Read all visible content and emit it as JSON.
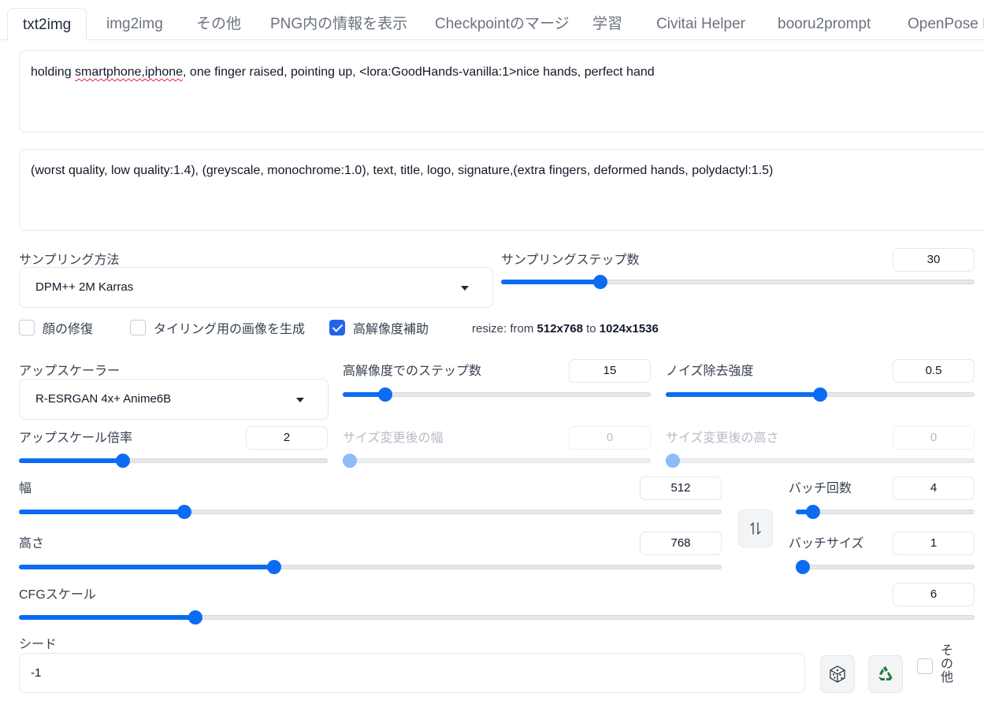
{
  "tabs": [
    "txt2img",
    "img2img",
    "その他",
    "PNG内の情報を表示",
    "Checkpointのマージ",
    "学習",
    "Civitai Helper",
    "booru2prompt",
    "OpenPose E"
  ],
  "prompt": {
    "pre": "holding ",
    "spell": "smartphone,iphone",
    "post": ", one finger raised, pointing up, <lora:GoodHands-vanilla:1>nice hands, perfect hand"
  },
  "negative_prompt": "(worst quality, low quality:1.4), (greyscale, monochrome:1.0), text, title, logo, signature,(extra fingers, deformed hands, polydactyl:1.5)",
  "sampling": {
    "method_label": "サンプリング方法",
    "method_value": "DPM++ 2M Karras",
    "steps_label": "サンプリングステップ数",
    "steps_value": "30",
    "steps_fraction": 0.2
  },
  "checks": {
    "face_restore": "顔の修復",
    "tiling": "タイリング用の画像を生成",
    "hires": "高解像度補助",
    "hires_checked": true
  },
  "resize_info": {
    "prefix": "resize: from ",
    "from": "512x768",
    "mid": " to ",
    "to": "1024x1536"
  },
  "hires": {
    "upscaler_label": "アップスケーラー",
    "upscaler_value": "R-ESRGAN 4x+ Anime6B",
    "hires_steps_label": "高解像度でのステップ数",
    "hires_steps_value": "15",
    "hires_steps_fraction": 0.12,
    "denoise_label": "ノイズ除去強度",
    "denoise_value": "0.5",
    "denoise_fraction": 0.5,
    "scale_label": "アップスケール倍率",
    "scale_value": "2",
    "scale_fraction": 0.33,
    "resize_w_label": "サイズ変更後の幅",
    "resize_w_value": "0",
    "resize_h_label": "サイズ変更後の高さ",
    "resize_h_value": "0"
  },
  "size": {
    "width_label": "幅",
    "width_value": "512",
    "width_fraction": 0.23,
    "height_label": "高さ",
    "height_value": "768",
    "height_fraction": 0.36
  },
  "batch": {
    "count_label": "バッチ回数",
    "count_value": "4",
    "count_fraction": 0.06,
    "size_label": "バッチサイズ",
    "size_value": "1",
    "size_fraction": 0.0
  },
  "cfg": {
    "label": "CFGスケール",
    "value": "6",
    "fraction": 0.18
  },
  "seed": {
    "label": "シード",
    "value": "-1",
    "extra_label": "その他"
  },
  "icons": {
    "swap": "swap-vertical-arrows-icon",
    "dice": "dice-icon",
    "recycle": "recycle-icon"
  }
}
